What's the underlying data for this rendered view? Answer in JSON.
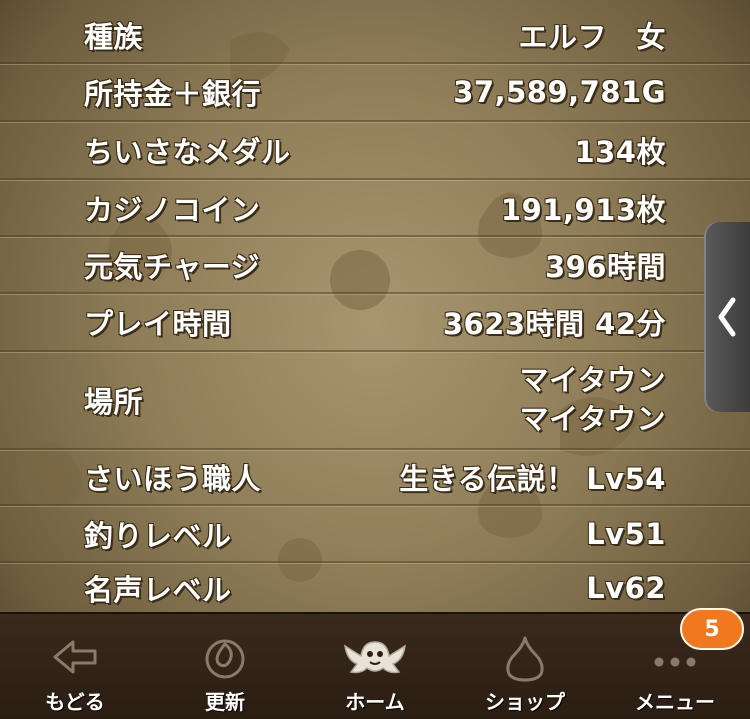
{
  "rows": [
    {
      "label": "種族",
      "value": "エルフ　女"
    },
    {
      "label": "所持金＋銀行",
      "value": "37,589,781G"
    },
    {
      "label": "ちいさなメダル",
      "value": "134枚"
    },
    {
      "label": "カジノコイン",
      "value": "191,913枚"
    },
    {
      "label": "元気チャージ",
      "value": "396時間"
    },
    {
      "label": "プレイ時間",
      "value": "3623時間 42分"
    },
    {
      "label": "場所",
      "value_lines": [
        "マイタウン",
        "マイタウン"
      ]
    },
    {
      "label": "さいほう職人",
      "value": "生きる伝説！ Lv54"
    },
    {
      "label": "釣りレベル",
      "value": "Lv51"
    },
    {
      "label": "名声レベル",
      "value": "Lv62"
    }
  ],
  "nav": {
    "back": {
      "label": "もどる",
      "icon": "back-arrow-icon"
    },
    "refresh": {
      "label": "更新",
      "icon": "refresh-icon"
    },
    "home": {
      "label": "ホーム",
      "icon": "home-monster-icon"
    },
    "shop": {
      "label": "ショップ",
      "icon": "slime-icon"
    },
    "menu": {
      "label": "メニュー",
      "icon": "more-dots-icon",
      "badge": "5"
    }
  },
  "side_tab": {
    "icon": "chevron-left-icon"
  },
  "colors": {
    "text": "#ffffff",
    "badge": "#f0781e",
    "nav_bg": "#2a1d12"
  }
}
